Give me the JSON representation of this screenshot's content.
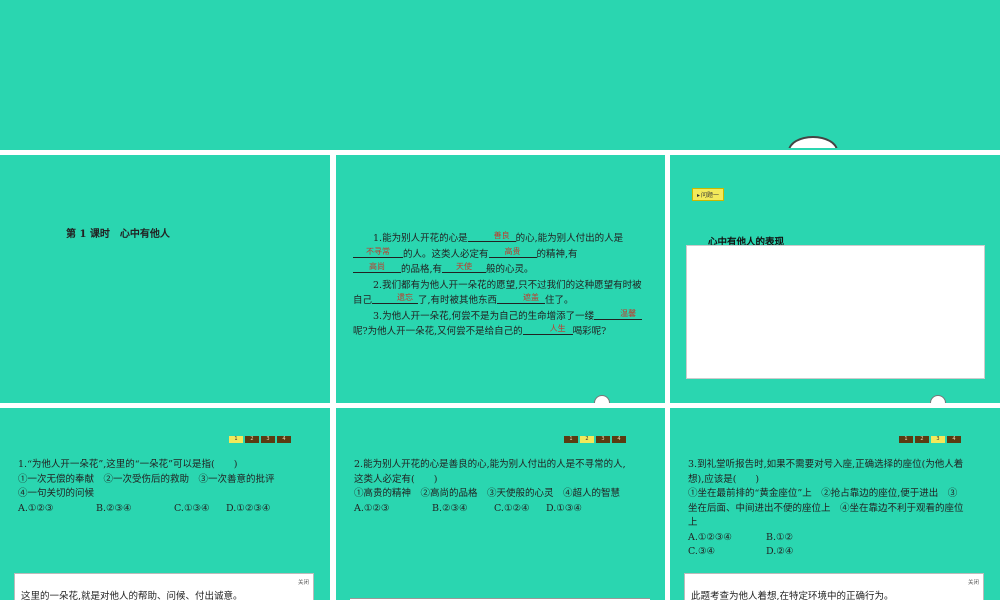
{
  "slide1": {
    "lesson": "第 1 课时",
    "title": "心中有他人"
  },
  "slide2": {
    "p1a": "1.能为别人开花的心是",
    "b1": "善良",
    "p1b": "的心,能为别人付出的人是",
    "b2": "不寻常",
    "p1c": "的人。这类人必定有",
    "b3": "高贵",
    "p1d": "的精神,有",
    "b4": "高尚",
    "p1e": "的品格,有",
    "b5": "天使",
    "p1f": "般的心灵。",
    "p2a": "2.我们都有为他人开一朵花的愿望,只不过我们的这种愿望有时被自己",
    "b6": "遗忘",
    "p2b": "了,有时被其他东西",
    "b7": "遮盖",
    "p2c": "住了。",
    "p3a": "3.为他人开一朵花,何尝不是为自己的生命增添了一缕",
    "b8": "温馨",
    "p3b": "呢?为他人开一朵花,又何尝不是给自己的",
    "b9": "人生",
    "p3c": "喝彩呢?"
  },
  "slide3": {
    "tag": "问题一",
    "heading": "心中有他人的表现"
  },
  "pager_labels": [
    "1",
    "2",
    "3",
    "4"
  ],
  "q1": {
    "stem": "1.“为他人开一朵花”,这里的“一朵花”可以是指(　　)",
    "line2": "①一次无偿的奉献　②一次受伤后的救助　③一次善意的批评",
    "line3": "④一句关切的问候",
    "opts": [
      "A.①②③",
      "B.②③④",
      "C.①③④",
      "D.①②③④"
    ],
    "close": "关闭",
    "answer": "这里的一朵花,就是对他人的帮助、问候、付出诚意。"
  },
  "q2": {
    "stem": "2.能为别人开花的心是善良的心,能为别人付出的人是不寻常的人,",
    "line2": "这类人必定有(　　)",
    "line3": "①高贵的精神　②高尚的品格　③天使般的心灵　④超人的智慧",
    "opts": [
      "A.①②③",
      "B.②③④",
      "C.①②④",
      "D.①③④"
    ]
  },
  "q3": {
    "stem": "3.到礼堂听报告时,如果不需要对号入座,正确选择的座位(为他人着",
    "line2": "想),应该是(　　)",
    "line3": "①坐在最前排的“黄金座位”上　②抢占靠边的座位,便于进出　③",
    "line4": "坐在后面、中间进出不便的座位上　④坐在靠边不利于观看的座位",
    "line5": "上",
    "opts": [
      "A.①②③④",
      "B.①②",
      "C.③④",
      "D.②④"
    ],
    "close": "关闭",
    "answer": "此题考查为他人着想,在特定环境中的正确行为。"
  },
  "colors": {
    "slide_bg": "#2ad6b0",
    "pager_active": "#f3e95a",
    "pager": "#5a3b12",
    "answer_red": "#c0392b"
  }
}
